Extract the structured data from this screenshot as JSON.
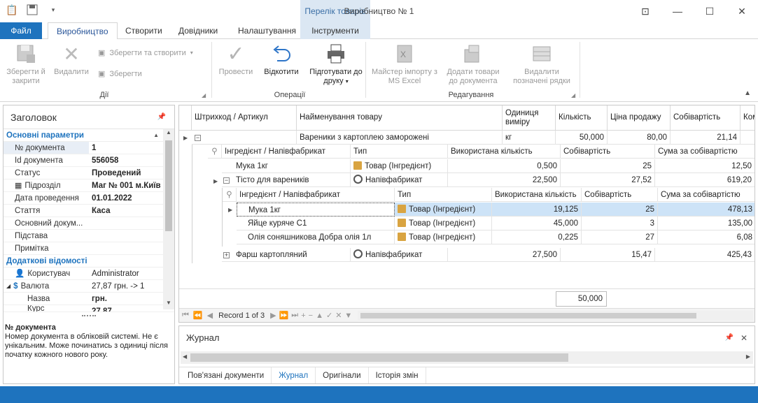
{
  "window": {
    "title": "Виробництво № 1",
    "context_group": "Перелік товарів",
    "quick_access": [
      "clipboard-icon",
      "save-icon",
      "customize-icon"
    ]
  },
  "tabs": {
    "file": "Файл",
    "items": [
      "Виробництво",
      "Створити",
      "Довідники",
      "Налаштування",
      "Інструменти"
    ],
    "active": "Виробництво"
  },
  "ribbon": {
    "save_close": "Зберегти й закрити",
    "delete": "Видалити",
    "save_create": "Зберегти та створити",
    "save": "Зберегти",
    "group_actions": "Дії",
    "post": "Провести",
    "undo": "Відкотити",
    "print": "Підготувати до друку",
    "group_ops": "Операції",
    "import_wizard": "Майстер імпорту з MS Excel",
    "add_goods": "Додати товари до документа",
    "delete_marked": "Видалити позначені рядки",
    "group_edit": "Редагування"
  },
  "left": {
    "header": "Заголовок",
    "cat_main": "Основні параметри",
    "props": [
      {
        "name": "№ документа",
        "value": "1"
      },
      {
        "name": "Id документа",
        "value": "556058"
      },
      {
        "name": "Статус",
        "value": "Проведений"
      },
      {
        "name": "Підрозділ",
        "value": "Маг № 001 м.Київ"
      },
      {
        "name": "Дата проведення",
        "value": "01.01.2022"
      },
      {
        "name": "Стаття",
        "value": "Каса"
      },
      {
        "name": "Основний докум...",
        "value": ""
      },
      {
        "name": "Підстава",
        "value": ""
      },
      {
        "name": "Примітка",
        "value": ""
      }
    ],
    "cat_extra": "Додаткові відомості",
    "extra": [
      {
        "name": "Користувач",
        "value": "Administrator"
      },
      {
        "name": "Валюта",
        "value": "27,87 грн. -> 1"
      },
      {
        "name": "Назва",
        "value": "грн."
      },
      {
        "name": "Курс",
        "value": "27,87"
      }
    ],
    "desc_title": "№ документа",
    "desc_text": "Номер документа в обліковій системі. Не є унікальним. Може починатись з одиниці після початку кожного нового року."
  },
  "grid": {
    "headers": [
      "Штрихкод / Артикул",
      "Найменування товару",
      "Одиниця виміру",
      "Кількість",
      "Ціна продажу",
      "Собівартість",
      "Ком"
    ],
    "main_row": {
      "name": "Вареники з картоплею заморожені",
      "unit": "кг",
      "qty": "50,000",
      "price": "80,00",
      "cost": "21,14"
    },
    "sub_headers": [
      "Інгредієнт / Напівфабрикат",
      "Тип",
      "Використана кількість",
      "Собівартість",
      "Сума за собівартістю"
    ],
    "sub_rows": [
      {
        "name": "Мука 1кг",
        "type": "Товар (Інгредієнт)",
        "qty": "0,500",
        "cost": "25",
        "sum": "12,50"
      },
      {
        "name": "Тісто для вареників",
        "type": "Напівфабрикат",
        "qty": "22,500",
        "cost": "27,52",
        "sum": "619,20"
      },
      {
        "name": "Фарш картопляний",
        "type": "Напівфабрикат",
        "qty": "27,500",
        "cost": "15,47",
        "sum": "425,43"
      }
    ],
    "subsub_headers": [
      "Інгредієнт / Напівфабрикат",
      "Тип",
      "Використана кількість",
      "Собівартість",
      "Сума за собівартістю"
    ],
    "subsub_rows": [
      {
        "name": "Мука 1кг",
        "type": "Товар (Інгредієнт)",
        "qty": "19,125",
        "cost": "25",
        "sum": "478,13"
      },
      {
        "name": "Яйце куряче С1",
        "type": "Товар (Інгредієнт)",
        "qty": "45,000",
        "cost": "3",
        "sum": "135,00"
      },
      {
        "name": "Олія соняшникова Добра олія 1л",
        "type": "Товар (Інгредієнт)",
        "qty": "0,225",
        "cost": "27",
        "sum": "6,08"
      }
    ],
    "footer_sum": "50,000",
    "record": "Record 1 of 3"
  },
  "journal": {
    "title": "Журнал",
    "tabs": [
      "Пов'язані документи",
      "Журнал",
      "Оригінали",
      "Історія змін"
    ],
    "active": "Журнал"
  },
  "colors": {
    "accent": "#1e73be",
    "context": "#dbe7f3",
    "selected": "#cde3f7"
  }
}
